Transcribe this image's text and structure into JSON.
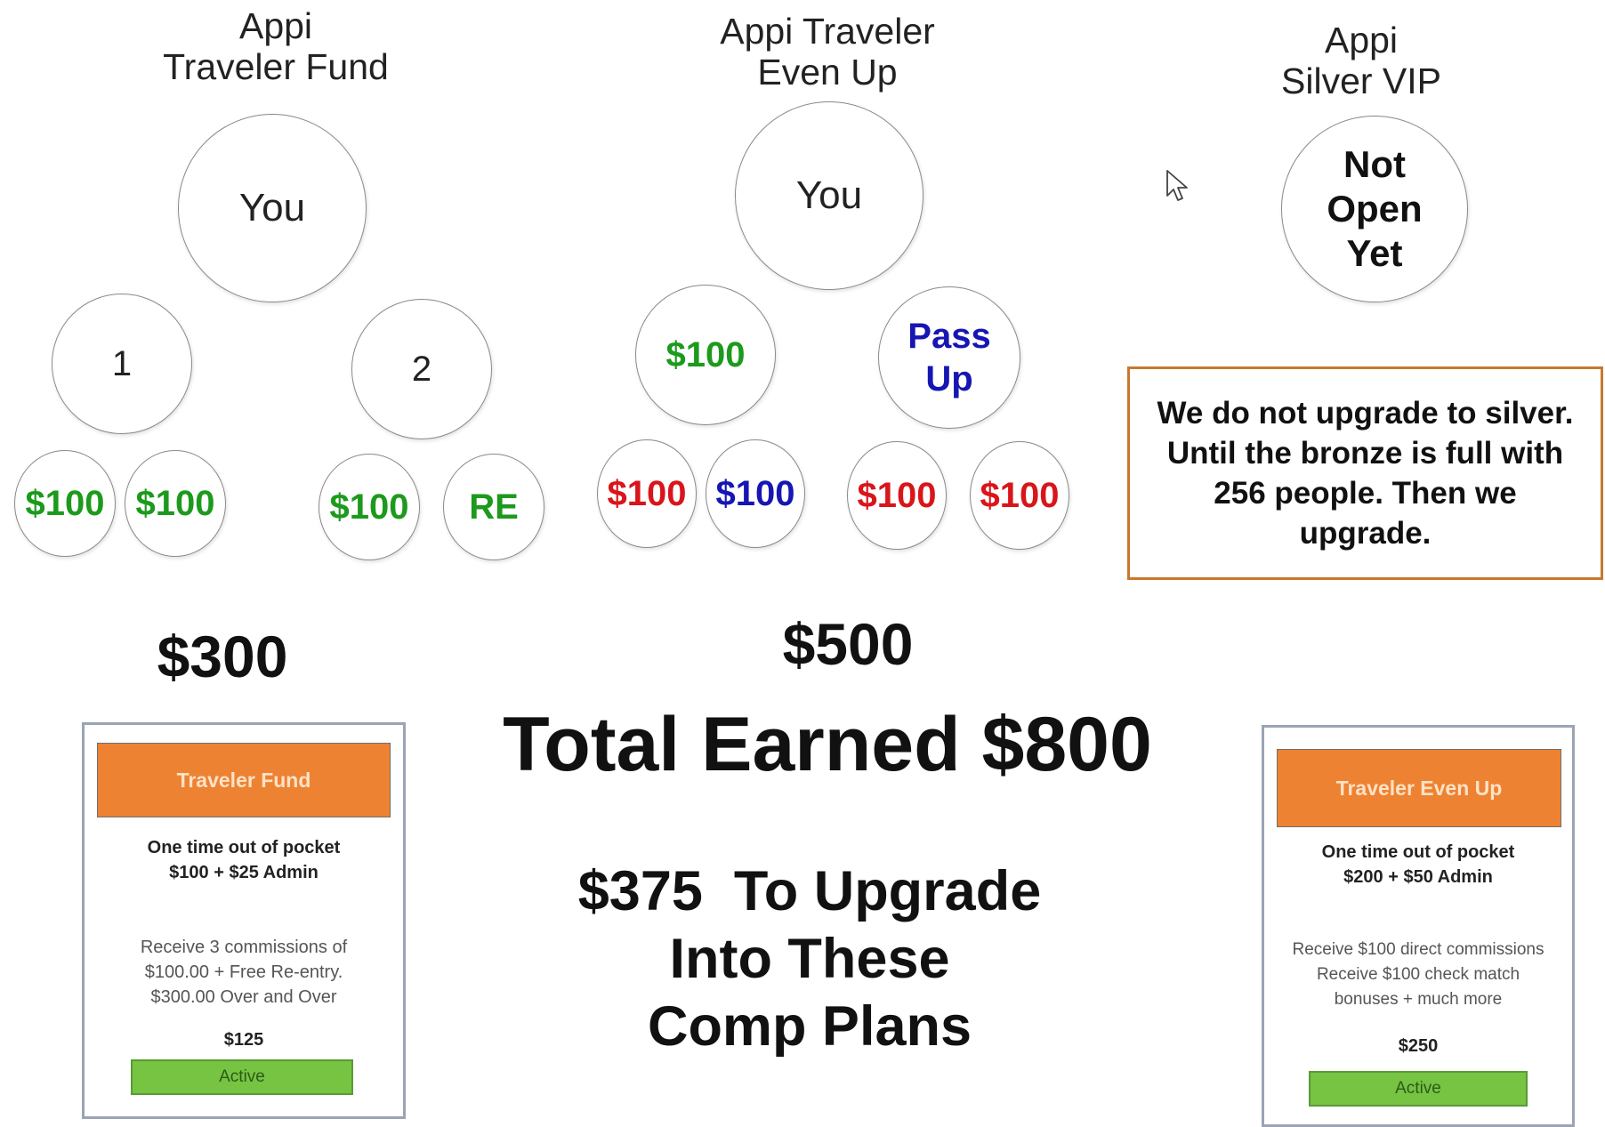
{
  "plans": {
    "fund": {
      "title_line1": "Appi",
      "title_line2": "Traveler Fund",
      "top": "You",
      "left_child": "1",
      "right_child": "2",
      "leaves": [
        "$100",
        "$100",
        "$100",
        "RE"
      ],
      "amount": "$300"
    },
    "evenup": {
      "title_line1": "Appi Traveler",
      "title_line2": "Even Up",
      "top": "You",
      "left_child": "$100",
      "right_child_line1": "Pass",
      "right_child_line2": "Up",
      "leaves": [
        "$100",
        "$100",
        "$100",
        "$100"
      ],
      "amount": "$500"
    },
    "silver": {
      "title_line1": "Appi",
      "title_line2": "Silver VIP",
      "status_line1": "Not",
      "status_line2": "Open",
      "status_line3": "Yet"
    }
  },
  "note": "We do not upgrade to silver. Until the bronze is full with 256 people. Then we upgrade.",
  "total": "Total Earned $800",
  "upgrade": {
    "line1": "$375  To Upgrade",
    "line2": "Into These",
    "line3": "Comp Plans"
  },
  "cards": {
    "fund": {
      "header": "Traveler Fund",
      "cost_line1": "One time out of pocket",
      "cost_line2": "$100 + $25 Admin",
      "desc_line1": "Receive 3 commissions of",
      "desc_line2": "$100.00 + Free Re-entry.",
      "desc_line3": "$300.00 Over and Over",
      "price": "$125",
      "button": "Active"
    },
    "evenup": {
      "header": "Traveler Even Up",
      "cost_line1": "One time out of pocket",
      "cost_line2": "$200 + $50 Admin",
      "desc_line1": "Receive $100 direct commissions",
      "desc_line2": "Receive $100 check match",
      "desc_line3": "bonuses + much more",
      "price": "$250",
      "button": "Active"
    }
  },
  "colors": {
    "green": "#1c9a1c",
    "red": "#d9151b",
    "blue": "#1616b3",
    "note_border": "#c8782e",
    "card_header": "#ee8233",
    "card_button": "#76c442"
  },
  "icons": {
    "cursor": "mouse-pointer-icon"
  }
}
